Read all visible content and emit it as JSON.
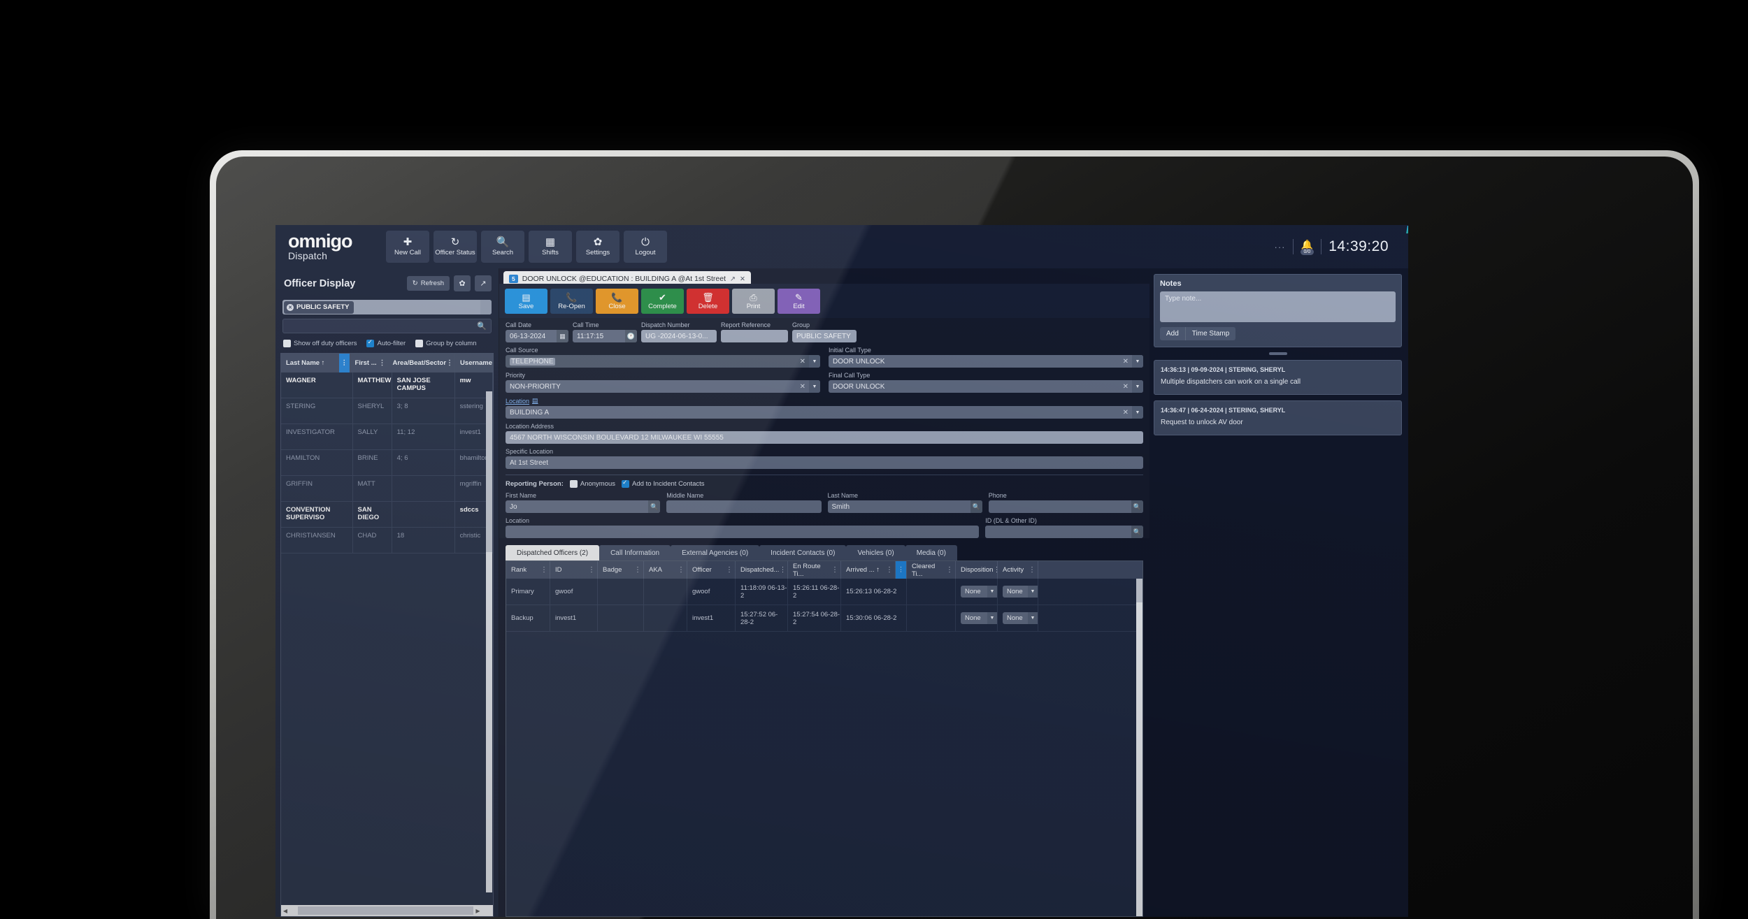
{
  "app": {
    "brand": "omnigo",
    "brand_sub": "Dispatch"
  },
  "topnav": [
    {
      "label": "New Call",
      "icon": "plus-icon",
      "glyph": "✚"
    },
    {
      "label": "Officer Status",
      "icon": "refresh-user-icon",
      "glyph": "↻"
    },
    {
      "label": "Search",
      "icon": "search-icon",
      "glyph": "🔍"
    },
    {
      "label": "Shifts",
      "icon": "calendar-icon",
      "glyph": "▦"
    },
    {
      "label": "Settings",
      "icon": "gear-icon",
      "glyph": "✿"
    },
    {
      "label": "Logout",
      "icon": "power-icon",
      "glyph": "⏻"
    }
  ],
  "topright": {
    "overflow": "···",
    "bell_icon": "bell-icon",
    "bell_badge": "0/0",
    "clock": "14:39:20"
  },
  "officer_display": {
    "title": "Officer Display",
    "refresh_label": "Refresh",
    "settings_icon": "gear-icon",
    "popout_icon": "external-link-icon",
    "chip": "PUBLIC SAFETY",
    "search_placeholder": "",
    "checkboxes": [
      {
        "label": "Show off duty officers",
        "checked": false
      },
      {
        "label": "Auto-filter",
        "checked": true
      },
      {
        "label": "Group by column",
        "checked": false
      }
    ],
    "columns": [
      "Last Name ↑",
      "First ...",
      "Area/Beat/Sector",
      "Username"
    ],
    "rows": [
      {
        "last": "CHRISTIANSEN",
        "first": "CHAD",
        "area": "18",
        "user": "christic",
        "highlight": false
      },
      {
        "last": "CONVENTION SUPERVISO",
        "first": "SAN DIEGO",
        "area": "",
        "user": "sdccs",
        "highlight": true
      },
      {
        "last": "GRIFFIN",
        "first": "MATT",
        "area": "",
        "user": "mgriffin",
        "highlight": false
      },
      {
        "last": "HAMILTON",
        "first": "BRINE",
        "area": "4; 6",
        "user": "bhamilton",
        "highlight": false
      },
      {
        "last": "INVESTIGATOR",
        "first": "SALLY",
        "area": "11; 12",
        "user": "invest1",
        "highlight": false
      },
      {
        "last": "STERING",
        "first": "SHERYL",
        "area": "3; 8",
        "user": "sstering",
        "highlight": false
      },
      {
        "last": "WAGNER",
        "first": "MATTHEW",
        "area": "SAN JOSE CAMPUS",
        "user": "mw",
        "highlight": true
      }
    ]
  },
  "call_tab": {
    "number": "5",
    "title": "DOOR UNLOCK @EDUCATION : BUILDING A @At 1st Street",
    "popout_icon": "external-link-icon",
    "close_icon": "close-icon"
  },
  "actions": [
    {
      "label": "Save",
      "icon": "save-icon",
      "glyph": "▤",
      "color": "#1a8fe0"
    },
    {
      "label": "Re-Open",
      "icon": "phone-out-icon",
      "glyph": "📞",
      "color": "#1b3a63"
    },
    {
      "label": "Close",
      "icon": "phone-close-icon",
      "glyph": "📞",
      "color": "#e8941a"
    },
    {
      "label": "Complete",
      "icon": "check-circle-icon",
      "glyph": "✔",
      "color": "#1d8a3d"
    },
    {
      "label": "Delete",
      "icon": "trash-icon",
      "glyph": "🗑",
      "color": "#d52020"
    },
    {
      "label": "Print",
      "icon": "printer-icon",
      "glyph": "⎙",
      "color": "#9aa1ad"
    },
    {
      "label": "Edit",
      "icon": "pencil-icon",
      "glyph": "✎",
      "color": "#7c58b8"
    }
  ],
  "form": {
    "call_date": {
      "label": "Call Date",
      "value": "06-13-2024",
      "icon": "calendar-icon"
    },
    "call_time": {
      "label": "Call Time",
      "value": "11:17:15",
      "icon": "clock-icon"
    },
    "dispatch_number": {
      "label": "Dispatch Number",
      "value": "UG  -2024-06-13-0..."
    },
    "report_reference": {
      "label": "Report Reference",
      "value": ""
    },
    "group": {
      "label": "Group",
      "value": "PUBLIC SAFETY"
    },
    "call_source": {
      "label": "Call Source",
      "value": "TELEPHONE"
    },
    "initial_call_type": {
      "label": "Initial Call Type",
      "value": "DOOR UNLOCK"
    },
    "priority": {
      "label": "Priority",
      "value": "NON-PRIORITY"
    },
    "final_call_type": {
      "label": "Final Call Type",
      "value": "DOOR UNLOCK"
    },
    "location": {
      "label": "Location",
      "value": "BUILDING A",
      "icon": "document-icon"
    },
    "location_address": {
      "label": "Location Address",
      "value": "4567 NORTH WISCONSIN BOULEVARD 12 MILWAUKEE WI 55555"
    },
    "specific_location": {
      "label": "Specific Location",
      "value": "At 1st Street"
    },
    "reporting_person": {
      "label": "Reporting Person:",
      "anonymous": {
        "label": "Anonymous",
        "checked": false
      },
      "add_contacts": {
        "label": "Add to Incident Contacts",
        "checked": true
      }
    },
    "first_name": {
      "label": "First Name",
      "value": "Jo"
    },
    "middle_name": {
      "label": "Middle Name",
      "value": ""
    },
    "last_name": {
      "label": "Last Name",
      "value": "Smith"
    },
    "phone": {
      "label": "Phone",
      "value": ""
    },
    "rp_location": {
      "label": "Location",
      "value": ""
    },
    "id_dl": {
      "label": "ID (DL & Other ID)",
      "value": ""
    }
  },
  "bottom_tabs": [
    {
      "label": "Dispatched Officers (2)",
      "active": true
    },
    {
      "label": "Call Information",
      "active": false
    },
    {
      "label": "External Agencies (0)",
      "active": false
    },
    {
      "label": "Incident Contacts (0)",
      "active": false
    },
    {
      "label": "Vehicles (0)",
      "active": false
    },
    {
      "label": "Media (0)",
      "active": false
    }
  ],
  "officer_grid": {
    "columns": [
      "Rank",
      "ID",
      "Badge",
      "AKA",
      "Officer",
      "Dispatched...",
      "En Route Ti...",
      "Arrived ... ↑",
      "Cleared Ti...",
      "Disposition",
      "Activity"
    ],
    "rows": [
      {
        "rank": "Primary",
        "id": "gwoof",
        "badge": "",
        "aka": "",
        "officer": "gwoof",
        "dispatched": "11:18:09 06-13-2",
        "enroute": "15:26:11 06-28-2",
        "arrived": "15:26:13 06-28-2",
        "cleared": "",
        "disposition": "None",
        "activity": "None"
      },
      {
        "rank": "Backup",
        "id": "invest1",
        "badge": "",
        "aka": "",
        "officer": "invest1",
        "dispatched": "15:27:52 06-28-2",
        "enroute": "15:27:54 06-28-2",
        "arrived": "15:30:06 06-28-2",
        "cleared": "",
        "disposition": "None",
        "activity": "None"
      }
    ]
  },
  "notes": {
    "title": "Notes",
    "placeholder": "Type note...",
    "add_label": "Add",
    "timestamp_label": "Time Stamp",
    "entries": [
      {
        "meta": "14:36:13 | 09-09-2024 | STERING, SHERYL",
        "text": "Multiple dispatchers can work on a single call"
      },
      {
        "meta": "14:36:47 | 06-24-2024 | STERING, SHERYL",
        "text": "Request to unlock AV door"
      }
    ]
  },
  "colors": {
    "accent": "#1d7fd6",
    "topbar": "#141c33",
    "panel": "#12182b"
  }
}
